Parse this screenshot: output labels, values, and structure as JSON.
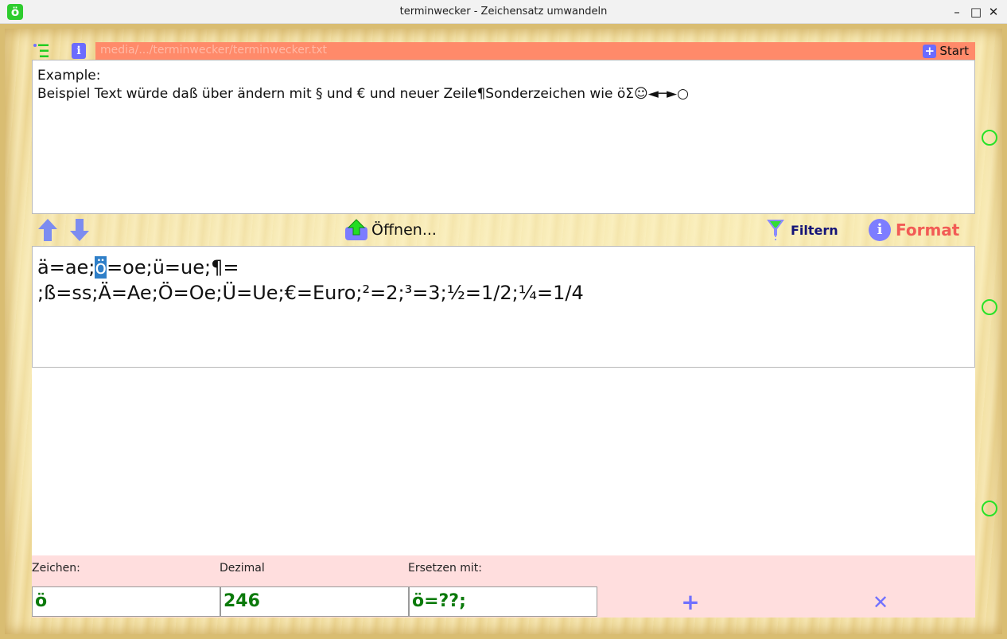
{
  "window": {
    "app_icon_glyph": "ö",
    "title": "terminwecker - Zeichensatz umwandeln",
    "minimize": "–",
    "maximize": "□",
    "close": "✕"
  },
  "header": {
    "path": "media/.../terminwecker/terminwecker.txt",
    "start_label": "Start"
  },
  "example": {
    "line1": "Example:",
    "line2": "Beispiel Text würde daß über ändern mit § und € und neuer Zeile¶Sonderzeichen wie öΣ☺◄─►○"
  },
  "toolbar": {
    "open_label": "Öffnen...",
    "filter_label": "Filtern",
    "format_label": "Format"
  },
  "rules": {
    "line1_before": "ä=ae;",
    "line1_selected": "ö",
    "line1_after": "=oe;ü=ue;¶=",
    "line2": ";ß=ss;Ä=Ae;Ö=Oe;Ü=Ue;€=Euro;²=2;³=3;½=1/2;¼=1/4"
  },
  "fields": {
    "zeichen_label": "Zeichen:",
    "zeichen_value": "ö",
    "dezimal_label": "Dezimal",
    "dezimal_value": "246",
    "ersetzen_label": "Ersetzen mit:",
    "ersetzen_value": "ö=??;"
  },
  "actions": {
    "add_glyph": "+",
    "remove_glyph": "✕"
  },
  "colors": {
    "path_bar": "#ff8a6a",
    "accent_blue": "#6b6bff",
    "field_green": "#0b7a0b",
    "format_red": "#f25b55",
    "bottom_panel": "#ffdede"
  }
}
